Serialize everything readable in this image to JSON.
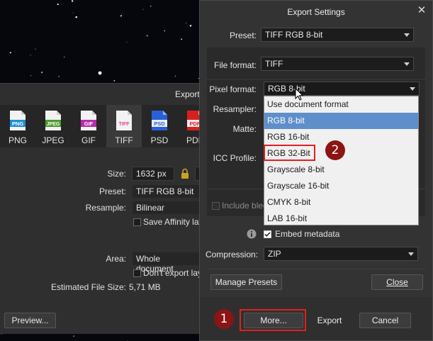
{
  "export_dialog": {
    "title": "Export",
    "formats": [
      {
        "label": "PNG",
        "icon": "png-file-icon",
        "color": "#1e8fd6"
      },
      {
        "label": "JPEG",
        "icon": "jpeg-file-icon",
        "color": "#4a9a2a"
      },
      {
        "label": "GIF",
        "icon": "gif-file-icon",
        "color": "#b52fa8"
      },
      {
        "label": "TIFF",
        "icon": "tiff-file-icon",
        "color": "#e0418f"
      },
      {
        "label": "PSD",
        "icon": "psd-file-icon",
        "color": "#2a5fd8"
      },
      {
        "label": "PDF",
        "icon": "pdf-file-icon",
        "color": "#d62020"
      }
    ],
    "size_label": "Size:",
    "size_value": "1632 px",
    "preset_label": "Preset:",
    "preset_value": "TIFF RGB 8-bit",
    "resample_label": "Resample:",
    "resample_value": "Bilinear",
    "save_affinity_label": "Save Affinity lay",
    "area_label": "Area:",
    "area_value": "Whole document",
    "dont_export_label": "Don't export lay",
    "estimated_size_label": "Estimated File Size:",
    "estimated_size_value": "5,71 MB",
    "preview_label": "Preview..."
  },
  "export_settings": {
    "title": "Export Settings",
    "preset_label": "Preset:",
    "preset_value": "TIFF RGB 8-bit",
    "file_format_label": "File format:",
    "file_format_value": "TIFF",
    "pixel_format_label": "Pixel format:",
    "pixel_format_value": "RGB 8-bit",
    "resampler_label": "Resampler:",
    "matte_label": "Matte:",
    "icc_profile_label": "ICC Profile:",
    "include_bleed_label": "Include blee",
    "embed_metadata_label": "Embed metadata",
    "compression_label": "Compression:",
    "compression_value": "ZIP",
    "manage_presets_label": "Manage Presets",
    "close_label": "Close",
    "more_label": "More...",
    "export_label": "Export",
    "cancel_label": "Cancel",
    "pixel_format_options": [
      "Use document format",
      "RGB 8-bit",
      "RGB 16-bit",
      "RGB 32-Bit",
      "Grayscale 8-bit",
      "Grayscale 16-bit",
      "CMYK 8-bit",
      "LAB 16-bit"
    ],
    "selected_option": "RGB 8-bit"
  },
  "annotations": {
    "badge_1": "1",
    "badge_2": "2",
    "accent_color": "#e02020"
  }
}
